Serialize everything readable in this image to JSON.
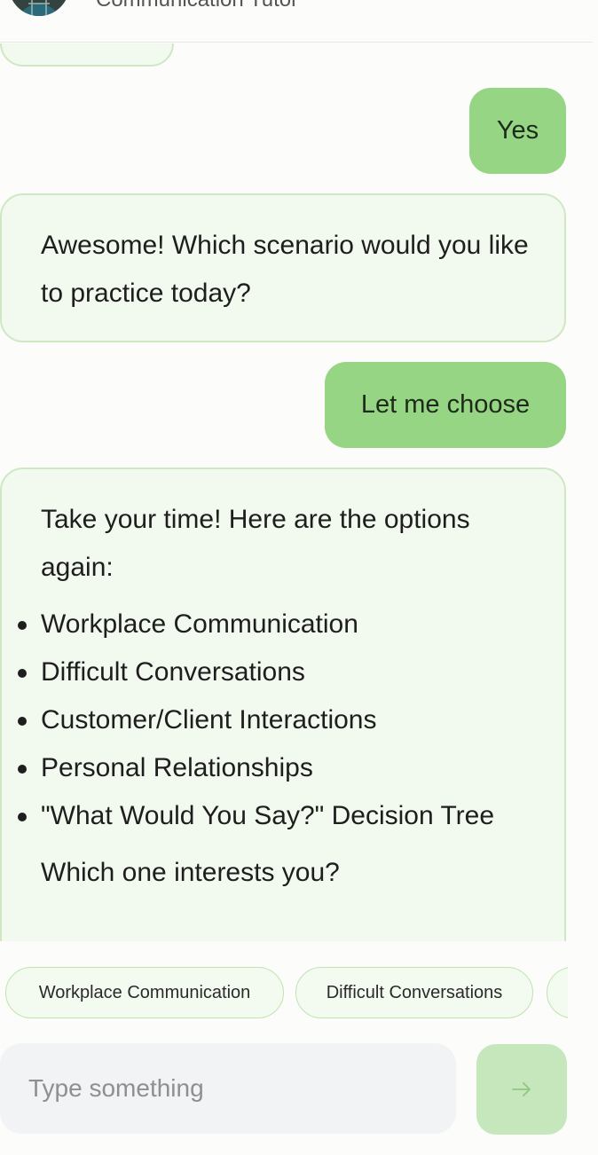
{
  "header": {
    "subtitle": "Communication Tutor"
  },
  "messages": [
    {
      "role": "user",
      "text": "Yes"
    },
    {
      "role": "bot",
      "text": "Awesome! Which scenario would you like to practice today?"
    },
    {
      "role": "user",
      "text": "Let me choose"
    },
    {
      "role": "bot",
      "intro": "Take your time! Here are the options again:",
      "options": [
        "Workplace Communication",
        "Difficult Conversations",
        "Customer/Client Interactions",
        "Personal Relationships",
        "\"What Would You Say?\" Decision Tree"
      ],
      "outro": "Which one interests you?"
    }
  ],
  "quick_replies": [
    "Workplace Communication",
    "Difficult Conversations"
  ],
  "input": {
    "placeholder": "Type something"
  },
  "icons": {
    "send": "arrow-right-icon",
    "avatar": "tutor-avatar"
  },
  "colors": {
    "user_bubble": "#95d584",
    "bot_bubble": "#f2f9ee",
    "bot_border": "#cfe8c4",
    "send_button": "#c6e6bb"
  }
}
